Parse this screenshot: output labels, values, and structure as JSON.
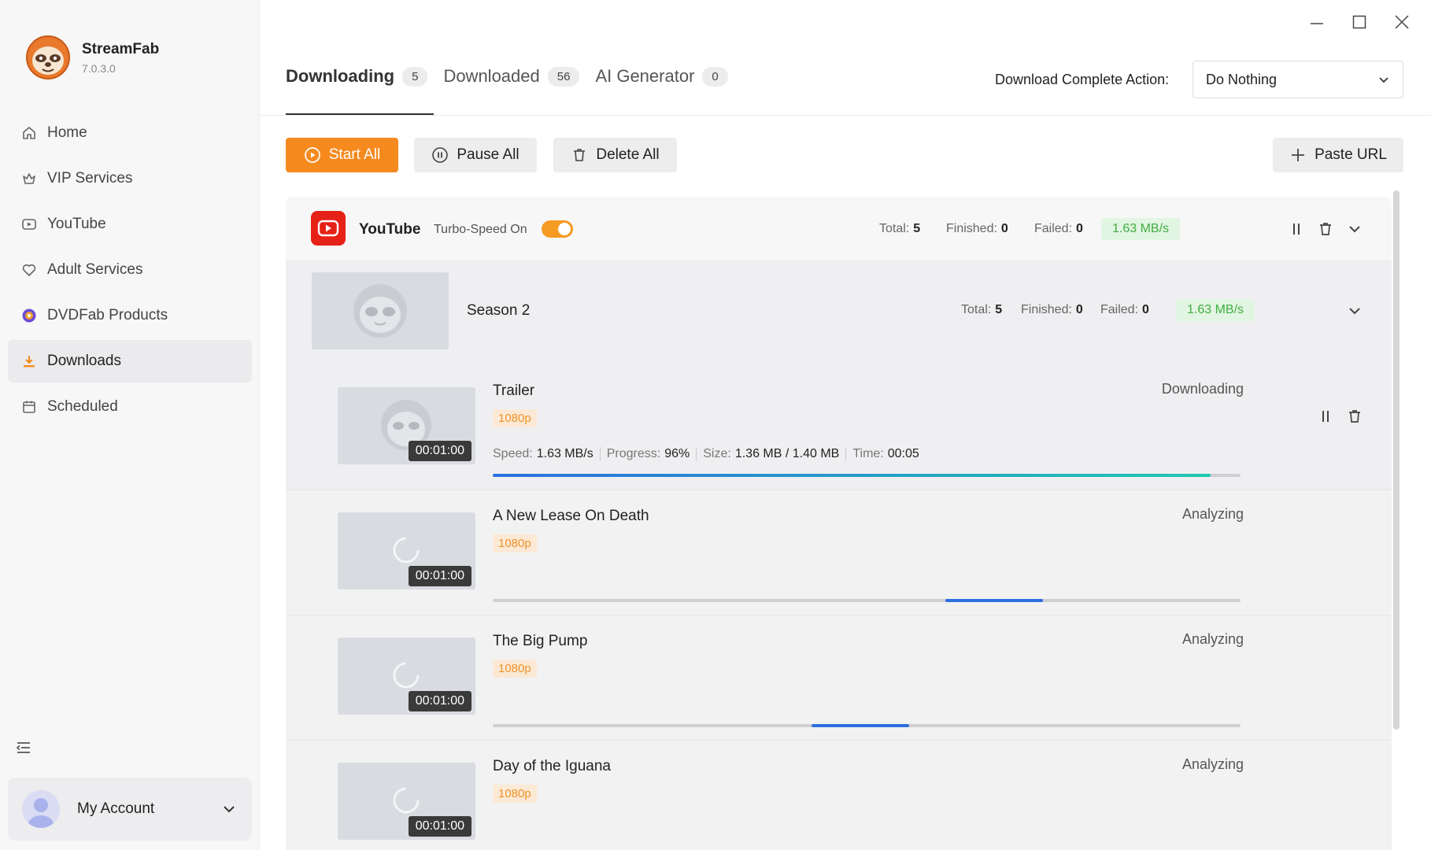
{
  "app": {
    "name": "StreamFab",
    "version": "7.0.3.0"
  },
  "sidebar": {
    "items": [
      {
        "label": "Home",
        "icon": "home-icon",
        "active": false
      },
      {
        "label": "VIP Services",
        "icon": "vip-icon",
        "active": false
      },
      {
        "label": "YouTube",
        "icon": "youtube-icon",
        "active": false
      },
      {
        "label": "Adult Services",
        "icon": "heart-icon",
        "active": false
      },
      {
        "label": "DVDFab Products",
        "icon": "dvdfab-icon",
        "active": false
      },
      {
        "label": "Downloads",
        "icon": "download-icon",
        "active": true
      },
      {
        "label": "Scheduled",
        "icon": "calendar-icon",
        "active": false
      }
    ],
    "account_label": "My Account"
  },
  "tabs": [
    {
      "label": "Downloading",
      "count": "5",
      "active": true
    },
    {
      "label": "Downloaded",
      "count": "56",
      "active": false
    },
    {
      "label": "AI Generator",
      "count": "0",
      "active": false
    }
  ],
  "complete_action": {
    "label": "Download Complete Action:",
    "value": "Do Nothing"
  },
  "toolbar": {
    "start_all": "Start All",
    "pause_all": "Pause All",
    "delete_all": "Delete All",
    "paste_url": "Paste URL"
  },
  "colors": {
    "accent": "#f68a1f",
    "youtube": "#e62117",
    "speed_green": "#3fae3f",
    "progress_blue": "#2c6fe0"
  },
  "group": {
    "title": "YouTube",
    "turbo_label": "Turbo-Speed On",
    "turbo_on": true,
    "total_label": "Total:",
    "total": "5",
    "finished_label": "Finished:",
    "finished": "0",
    "failed_label": "Failed:",
    "failed": "0",
    "speed": "1.63 MB/s"
  },
  "season": {
    "title": "Season 2",
    "total_label": "Total:",
    "total": "5",
    "finished_label": "Finished:",
    "finished": "0",
    "failed_label": "Failed:",
    "failed": "0",
    "speed": "1.63 MB/s"
  },
  "items": [
    {
      "title": "Trailer",
      "quality": "1080p",
      "duration": "00:01:00",
      "status": "Downloading",
      "speed_label": "Speed:",
      "speed": "1.63 MB/s",
      "progress_label": "Progress:",
      "progress": "96%",
      "size_label": "Size:",
      "size": "1.36 MB / 1.40 MB",
      "time_label": "Time:",
      "time": "00:05",
      "progress_fraction": 0.96
    },
    {
      "title": "A New Lease On Death",
      "quality": "1080p",
      "duration": "00:01:00",
      "status": "Analyzing"
    },
    {
      "title": "The Big Pump",
      "quality": "1080p",
      "duration": "00:01:00",
      "status": "Analyzing"
    },
    {
      "title": "Day of the Iguana",
      "quality": "1080p",
      "duration": "00:01:00",
      "status": "Analyzing"
    }
  ]
}
